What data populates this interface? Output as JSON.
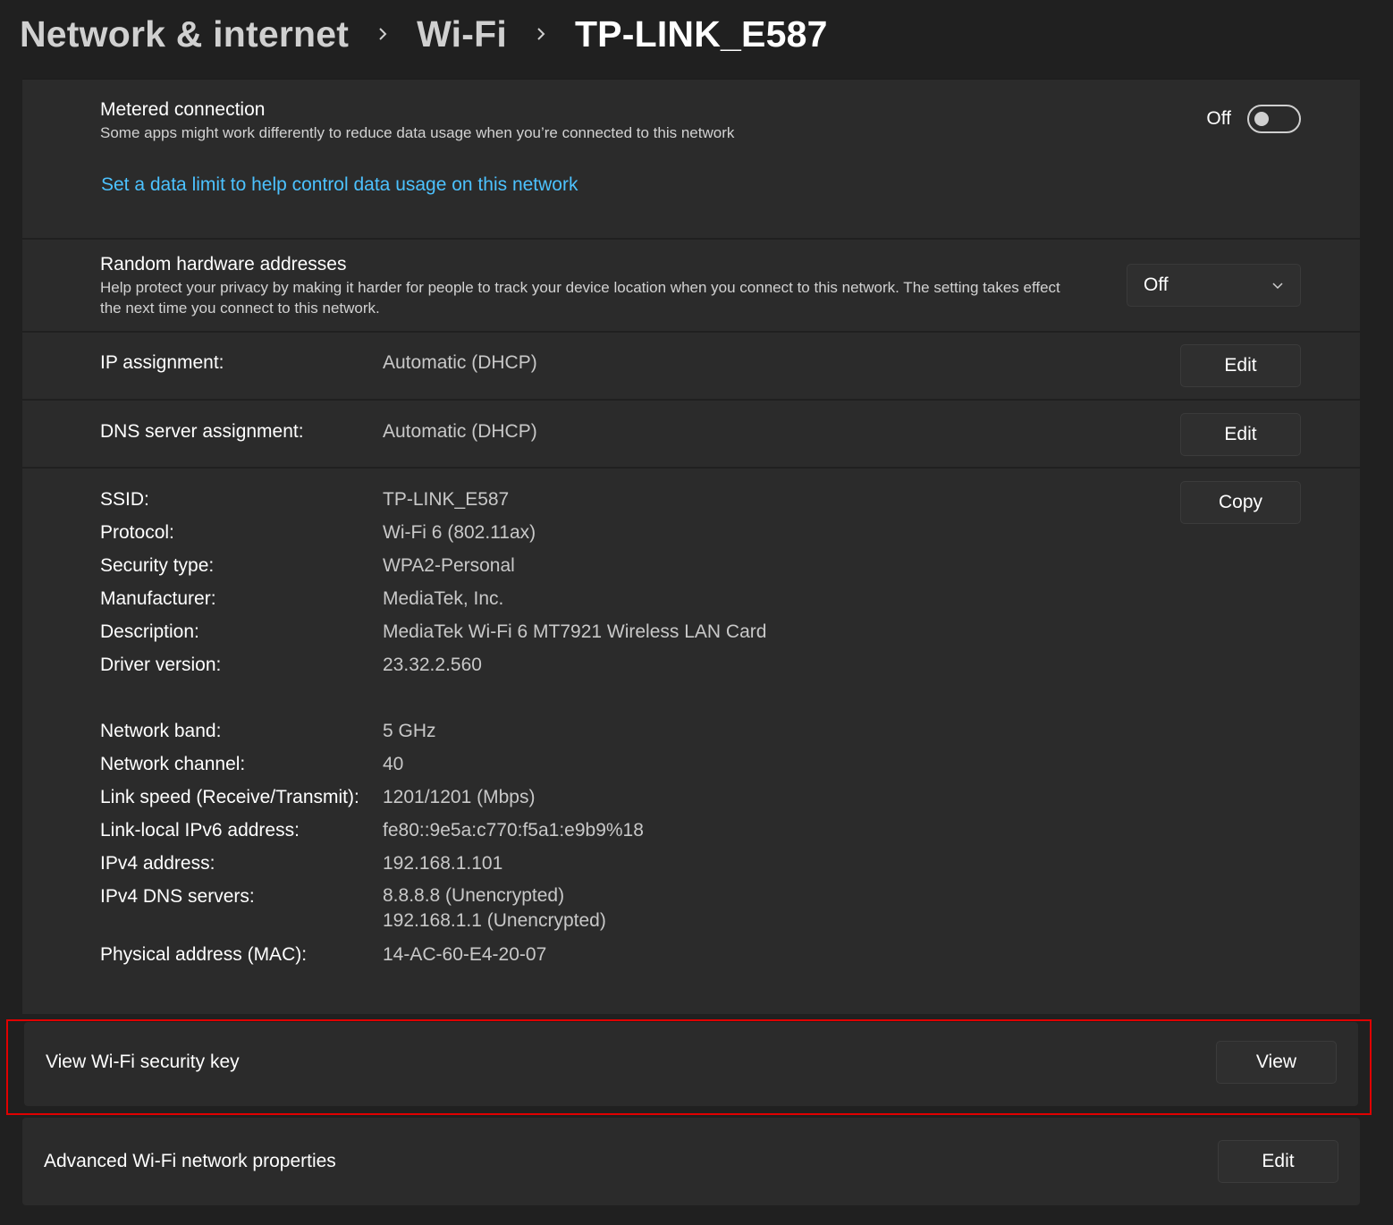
{
  "breadcrumb": {
    "items": [
      "Network & internet",
      "Wi-Fi",
      "TP-LINK_E587"
    ]
  },
  "metered": {
    "title": "Metered connection",
    "description": "Some apps might work differently to reduce data usage when you’re connected to this network",
    "toggle_state": "Off",
    "data_limit_link": "Set a data limit to help control data usage on this network"
  },
  "random_hw": {
    "title": "Random hardware addresses",
    "description": "Help protect your privacy by making it harder for people to track your device location when you connect to this network. The setting takes effect the next time you connect to this network.",
    "selected": "Off"
  },
  "ip_assignment": {
    "label": "IP assignment:",
    "value": "Automatic (DHCP)",
    "button": "Edit"
  },
  "dns_assignment": {
    "label": "DNS server assignment:",
    "value": "Automatic (DHCP)",
    "button": "Edit"
  },
  "properties": {
    "copy_button": "Copy",
    "group1": [
      {
        "label": "SSID:",
        "value": "TP-LINK_E587"
      },
      {
        "label": "Protocol:",
        "value": "Wi-Fi 6 (802.11ax)"
      },
      {
        "label": "Security type:",
        "value": "WPA2-Personal"
      },
      {
        "label": "Manufacturer:",
        "value": "MediaTek, Inc."
      },
      {
        "label": "Description:",
        "value": "MediaTek Wi-Fi 6 MT7921 Wireless LAN Card"
      },
      {
        "label": "Driver version:",
        "value": "23.32.2.560"
      }
    ],
    "group2": [
      {
        "label": "Network band:",
        "value": "5 GHz"
      },
      {
        "label": "Network channel:",
        "value": "40"
      },
      {
        "label": "Link speed (Receive/Transmit):",
        "value": "1201/1201 (Mbps)"
      },
      {
        "label": "Link-local IPv6 address:",
        "value": "fe80::9e5a:c770:f5a1:e9b9%18"
      },
      {
        "label": "IPv4 address:",
        "value": "192.168.1.101"
      }
    ],
    "dns_servers": {
      "label": "IPv4 DNS servers:",
      "values": [
        "8.8.8.8 (Unencrypted)",
        "192.168.1.1 (Unencrypted)"
      ]
    },
    "mac": {
      "label": "Physical address (MAC):",
      "value": "14-AC-60-E4-20-07"
    }
  },
  "security_key": {
    "title": "View Wi-Fi security key",
    "button": "View"
  },
  "advanced": {
    "title": "Advanced Wi-Fi network properties",
    "button": "Edit"
  },
  "colors": {
    "background": "#202020",
    "card": "#2b2b2b",
    "link": "#4cc2ff",
    "highlight": "#e00000"
  }
}
